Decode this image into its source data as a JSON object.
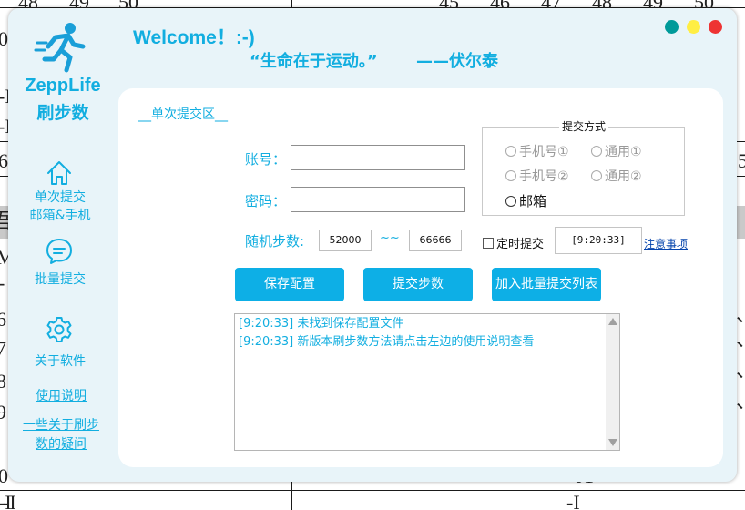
{
  "background_sheet": {
    "top_cells": [
      "48",
      "49",
      "50",
      "45",
      "46",
      "47",
      "48",
      "49",
      "50"
    ],
    "left_cells": [
      "0",
      "-I",
      "-I",
      "6",
      "吾",
      "M",
      "-",
      "6",
      "7",
      "8",
      "9",
      "0",
      "-I"
    ],
    "right_cells": [
      "5",
      "、",
      "、",
      "、",
      "、"
    ],
    "bottom_cells": [
      "01",
      "-I",
      "-I"
    ]
  },
  "window": {
    "buttons": [
      {
        "name": "minimize",
        "color": "#009a9a"
      },
      {
        "name": "maximize",
        "color": "#ffee44"
      },
      {
        "name": "close",
        "color": "#ee3333"
      }
    ]
  },
  "sidebar": {
    "logo_icon": "running-man-icon",
    "app_name_line1": "ZeppLife",
    "app_name_line2": "刷步数",
    "items": [
      {
        "icon": "home-icon",
        "label_line1": "单次提交",
        "label_line2": "邮箱&手机"
      },
      {
        "icon": "chat-bubble-icon",
        "label_line1": "批量提交"
      },
      {
        "icon": "gear-icon",
        "label_line1": "关于软件"
      }
    ],
    "links": {
      "usage_guide": "使用说明",
      "faq_line1": "一些关于刷步",
      "faq_line2": "数的疑问"
    }
  },
  "header": {
    "welcome": "Welcome！:-)",
    "quote": "“生命在于运动。”",
    "quote_author": "——伏尔泰"
  },
  "form": {
    "section_title": "__单次提交区__",
    "account_label": "账号：",
    "account_value": "",
    "password_label": "密码：",
    "password_value": "",
    "steps_label": "随机步数:",
    "steps_min": "52000",
    "steps_separator": "~~",
    "steps_max": "66666",
    "submit_method": {
      "title": "提交方式",
      "options": [
        {
          "label": "手机号①",
          "enabled": false
        },
        {
          "label": "通用①",
          "enabled": false
        },
        {
          "label": "手机号②",
          "enabled": false
        },
        {
          "label": "通用②",
          "enabled": false
        },
        {
          "label": "邮箱",
          "enabled": true
        }
      ]
    },
    "scheduled_label": "定时提交",
    "scheduled_checked": false,
    "scheduled_time": "[9:20:33]",
    "notice_link": "注意事项",
    "buttons": {
      "save": "保存配置",
      "submit": "提交步数",
      "add_batch": "加入批量提交列表"
    },
    "log": [
      "[9:20:33] 未找到保存配置文件",
      "[9:20:33] 新版本刷步数方法请点击左边的使用说明查看"
    ]
  },
  "colors": {
    "accent": "#12aee0",
    "button": "#0dafe6",
    "window_bg": "#e8f4f9",
    "panel_bg": "#ffffff"
  }
}
